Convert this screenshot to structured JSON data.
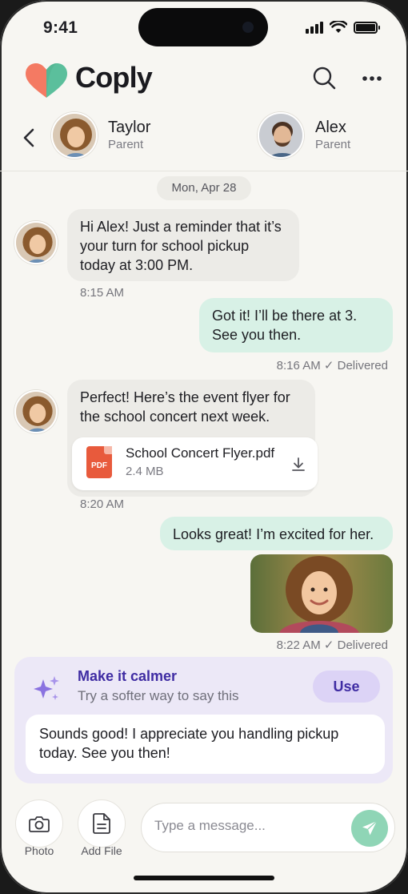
{
  "status_bar": {
    "time": "9:41"
  },
  "header": {
    "brand": "Coply",
    "colors": {
      "heart_left": "#f47a63",
      "heart_right": "#5bbf9c"
    }
  },
  "participants": [
    {
      "name": "Taylor",
      "role": "Parent"
    },
    {
      "name": "Alex",
      "role": "Parent"
    }
  ],
  "conversation": {
    "date": "Mon, Apr 28",
    "messages": [
      {
        "from": "Taylor",
        "text": "Hi Alex! Just a reminder that it’s your turn for school pickup today at 3:00 PM.",
        "time": "8:15 AM"
      },
      {
        "from": "Alex",
        "text": "Got it! I’ll be there at 3. See you then.",
        "time": "8:16 AM",
        "status": "✓ Delivered"
      },
      {
        "from": "Taylor",
        "text": "Perfect! Here’s the event flyer for the school concert next week.",
        "time": "8:20 AM",
        "attachment": {
          "badge": "PDF",
          "name": "School Concert Flyer.pdf",
          "size": "2.4 MB"
        }
      },
      {
        "from": "Alex",
        "text": "Looks great! I’m excited for her.",
        "time": "8:22 AM",
        "status": "✓ Delivered",
        "image": "child-photo"
      }
    ]
  },
  "suggestion": {
    "title": "Make it calmer",
    "subtitle": "Try a softer way to say this",
    "use_label": "Use",
    "text": "Sounds good! I appreciate you handling pickup today. See you then!"
  },
  "composer": {
    "photo_label": "Photo",
    "file_label": "Add File",
    "placeholder": "Type a message..."
  },
  "colors": {
    "background": "#f7f6f2",
    "incoming_bubble": "#ecebe7",
    "outgoing_bubble": "#d8f1e6",
    "accent_purple": "#3f2ca3",
    "send_button": "#8fd5b6"
  }
}
